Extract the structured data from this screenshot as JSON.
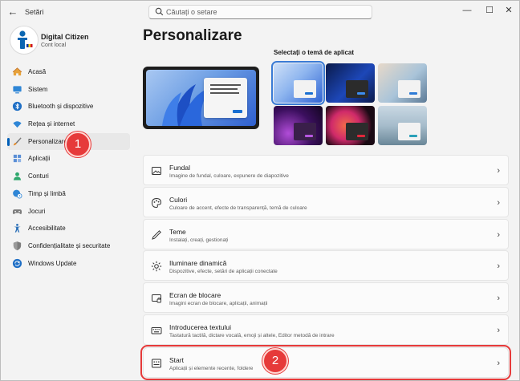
{
  "app": {
    "title": "Setări"
  },
  "window_controls": {
    "minimize": "—",
    "maximize": "☐",
    "close": "✕"
  },
  "search": {
    "placeholder": "Căutați o setare"
  },
  "profile": {
    "name": "Digital Citizen",
    "subtitle": "Cont local"
  },
  "sidebar": {
    "items": [
      {
        "label": "Acasă",
        "icon": "home-icon"
      },
      {
        "label": "Sistem",
        "icon": "system-icon"
      },
      {
        "label": "Bluetooth și dispozitive",
        "icon": "bluetooth-icon"
      },
      {
        "label": "Rețea și internet",
        "icon": "wifi-icon"
      },
      {
        "label": "Personalizare",
        "icon": "brush-icon",
        "active": true
      },
      {
        "label": "Aplicații",
        "icon": "apps-icon"
      },
      {
        "label": "Conturi",
        "icon": "user-icon"
      },
      {
        "label": "Timp și limbă",
        "icon": "globe-clock-icon"
      },
      {
        "label": "Jocuri",
        "icon": "gamepad-icon"
      },
      {
        "label": "Accesibilitate",
        "icon": "accessibility-icon"
      },
      {
        "label": "Confidențialitate și securitate",
        "icon": "shield-icon"
      },
      {
        "label": "Windows Update",
        "icon": "update-icon"
      }
    ]
  },
  "badges": {
    "first": "1",
    "second": "2"
  },
  "main": {
    "title": "Personalizare",
    "themes_title": "Selectați o temă de aplicat",
    "cards": [
      {
        "title": "Fundal",
        "subtitle": "Imagine de fundal, culoare, expunere de diapozitive",
        "icon": "image-icon"
      },
      {
        "title": "Culori",
        "subtitle": "Culoare de accent, efecte de transparență, temă de culoare",
        "icon": "palette-icon"
      },
      {
        "title": "Teme",
        "subtitle": "Instalați, creați, gestionați",
        "icon": "pen-icon"
      },
      {
        "title": "Iluminare dinamică",
        "subtitle": "Dispozitive, efecte, setări de aplicații conectate",
        "icon": "sun-icon"
      },
      {
        "title": "Ecran de blocare",
        "subtitle": "Imagini ecran de blocare, aplicații, animații",
        "icon": "lock-screen-icon"
      },
      {
        "title": "Introducerea textului",
        "subtitle": "Tastatură tactilă, dictare vocală, emoji și altele, Editor metodă de intrare",
        "icon": "keyboard-icon"
      },
      {
        "title": "Start",
        "subtitle": "Aplicații și elemente recente, foldere",
        "icon": "start-menu-icon",
        "highlight": true
      }
    ]
  },
  "colors": {
    "accent": "#005fb8",
    "annotation": "#e63a3a"
  }
}
